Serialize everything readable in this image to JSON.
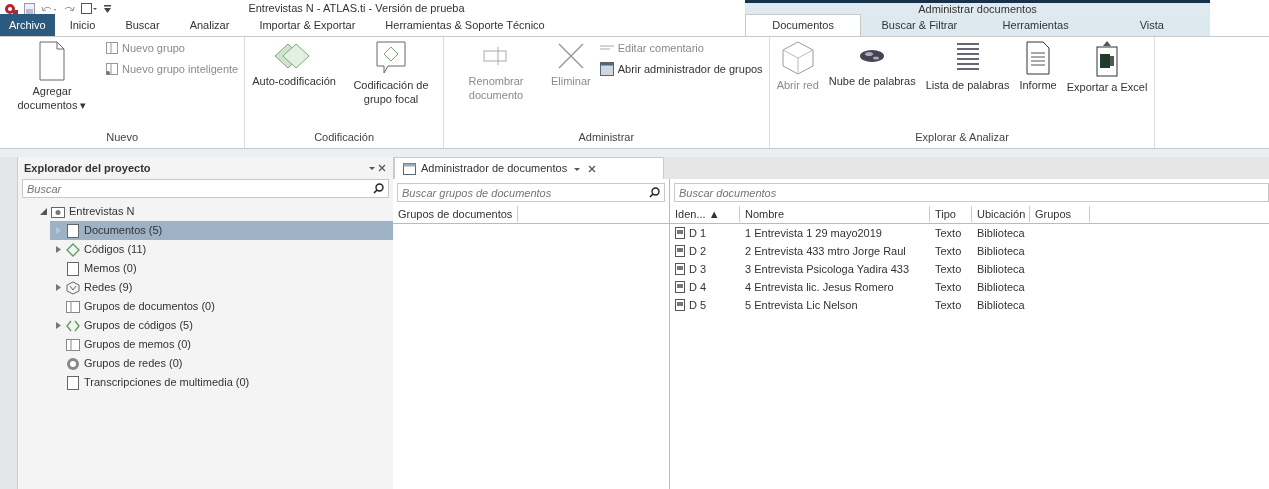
{
  "window": {
    "title": "Entrevistas N - ATLAS.ti - Versión de prueba"
  },
  "context_tab_group": {
    "label": "Administrar documentos"
  },
  "tabs": [
    {
      "label": "Archivo",
      "selected": false,
      "kind": "file"
    },
    {
      "label": "Inicio",
      "selected": false,
      "kind": "normal"
    },
    {
      "label": "Buscar",
      "selected": false,
      "kind": "normal"
    },
    {
      "label": "Analizar",
      "selected": false,
      "kind": "normal"
    },
    {
      "label": "Importar & Exportar",
      "selected": false,
      "kind": "normal"
    },
    {
      "label": "Herramientas & Soporte Técnico",
      "selected": false,
      "kind": "normal"
    },
    {
      "label": "Documentos",
      "selected": true,
      "kind": "contextual"
    },
    {
      "label": "Buscar & Filtrar",
      "selected": false,
      "kind": "contextual"
    },
    {
      "label": "Herramientas",
      "selected": false,
      "kind": "contextual"
    },
    {
      "label": "Vista",
      "selected": false,
      "kind": "contextual"
    }
  ],
  "ribbon": {
    "groups": [
      {
        "label": "Nuevo",
        "items": [
          {
            "kind": "large",
            "label": "Agregar documentos ▾",
            "disabled": false
          },
          {
            "kind": "small",
            "label": "Nuevo grupo",
            "disabled": true
          },
          {
            "kind": "small",
            "label": "Nuevo grupo inteligente",
            "disabled": true
          }
        ]
      },
      {
        "label": "Codificación",
        "items": [
          {
            "kind": "large",
            "label": "Auto-codificación",
            "disabled": false
          },
          {
            "kind": "large",
            "label": "Codificación de grupo focal",
            "disabled": false
          }
        ]
      },
      {
        "label": "Administrar",
        "items": [
          {
            "kind": "large",
            "label": "Renombrar documento",
            "disabled": true
          },
          {
            "kind": "large",
            "label": "Eliminar",
            "disabled": true
          },
          {
            "kind": "small",
            "label": "Editar comentario",
            "disabled": true
          },
          {
            "kind": "small",
            "label": "Abrir administrador de grupos",
            "disabled": false
          }
        ]
      },
      {
        "label": "Explorar & Analizar",
        "items": [
          {
            "kind": "large",
            "label": "Abrir red",
            "disabled": true
          },
          {
            "kind": "large",
            "label": "Nube de palabras",
            "disabled": false
          },
          {
            "kind": "large",
            "label": "Lista de palabras",
            "disabled": false
          },
          {
            "kind": "large",
            "label": "Informe",
            "disabled": false
          },
          {
            "kind": "large",
            "label": "Exportar a Excel",
            "disabled": false
          }
        ]
      }
    ]
  },
  "project_explorer": {
    "title": "Explorador del proyecto",
    "search": {
      "placeholder": "Buscar"
    },
    "tree": {
      "label": "Entrevistas N",
      "expanded": true,
      "children": [
        {
          "label": "Documentos (5)",
          "selected": true,
          "expandable": true
        },
        {
          "label": "Códigos (11)",
          "selected": false,
          "expandable": true
        },
        {
          "label": "Memos (0)",
          "selected": false,
          "expandable": false
        },
        {
          "label": "Redes (9)",
          "selected": false,
          "expandable": true
        },
        {
          "label": "Grupos de documentos (0)",
          "selected": false,
          "expandable": false
        },
        {
          "label": "Grupos de códigos (5)",
          "selected": false,
          "expandable": true
        },
        {
          "label": "Grupos de memos (0)",
          "selected": false,
          "expandable": false
        },
        {
          "label": "Grupos de redes (0)",
          "selected": false,
          "expandable": false
        },
        {
          "label": "Transcripciones de multimedia (0)",
          "selected": false,
          "expandable": false
        }
      ]
    }
  },
  "document_manager": {
    "tab_title": "Administrador de documentos",
    "groups_pane": {
      "search": {
        "placeholder": "Buscar grupos de documentos"
      },
      "column": "Grupos de documentos"
    },
    "documents_pane": {
      "search": {
        "placeholder": "Buscar documentos"
      },
      "columns": [
        "Iden... ▲",
        "Nombre",
        "Tipo",
        "Ubicación",
        "Grupos"
      ],
      "rows": [
        {
          "id": "D 1",
          "name": "1 Entrevista 1 29 mayo2019",
          "type": "Texto",
          "location": "Biblioteca"
        },
        {
          "id": "D 2",
          "name": "2 Entrevista 433 mtro Jorge Raul",
          "type": "Texto",
          "location": "Biblioteca"
        },
        {
          "id": "D 3",
          "name": "3 Entrevista  Psicologa Yadira 433",
          "type": "Texto",
          "location": "Biblioteca"
        },
        {
          "id": "D 4",
          "name": "4 Entrevista lic. Jesus Romero",
          "type": "Texto",
          "location": "Biblioteca"
        },
        {
          "id": "D 5",
          "name": "5 Entrevista Lic Nelson",
          "type": "Texto",
          "location": "Biblioteca"
        }
      ]
    }
  }
}
